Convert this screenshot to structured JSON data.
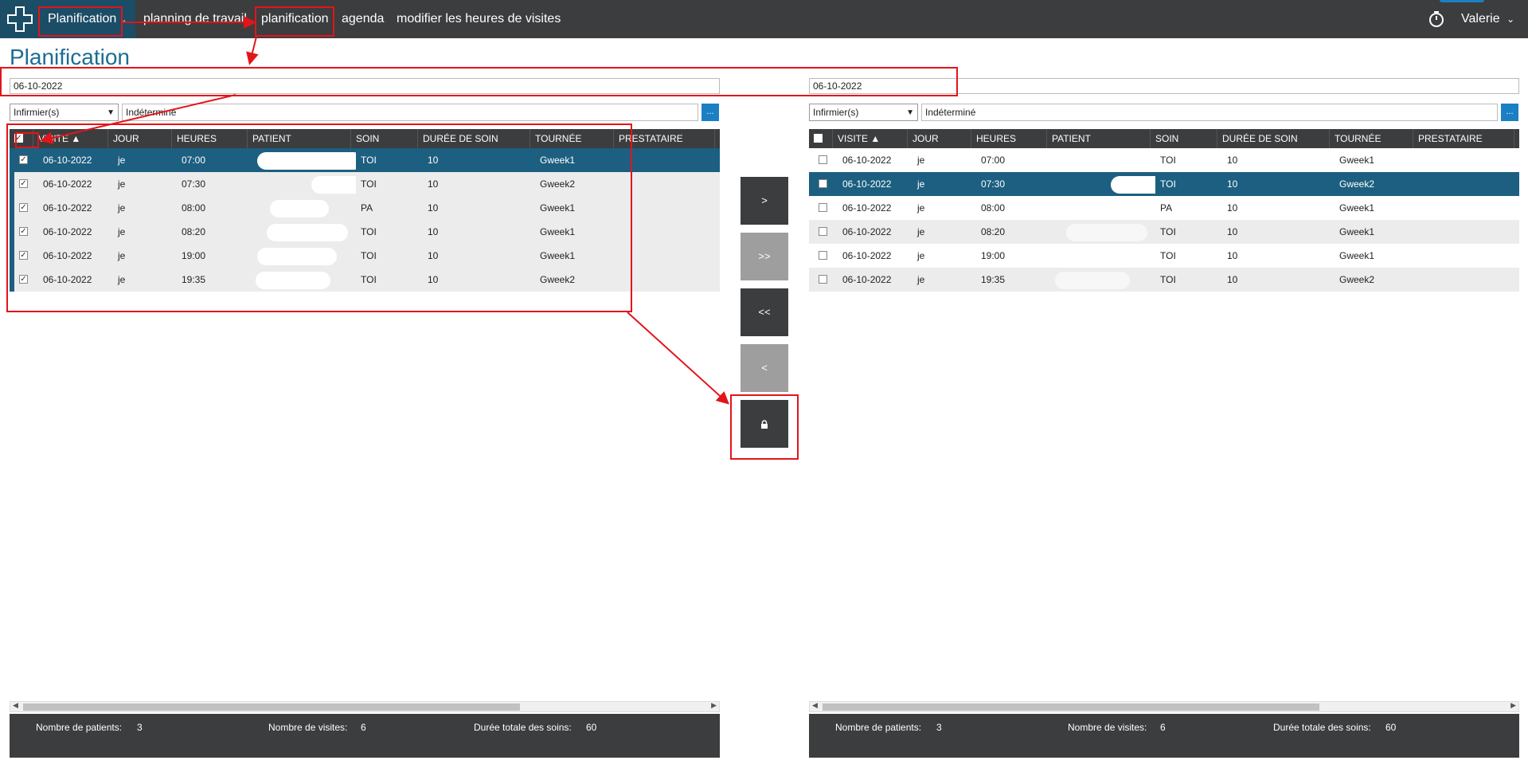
{
  "nav": {
    "app_menu": "Planification",
    "items": [
      "planning de travail",
      "planification",
      "agenda",
      "modifier les heures de visites"
    ],
    "user": "Valerie"
  },
  "page_title": "Planification",
  "columns": [
    "VISITE",
    "JOUR",
    "HEURES",
    "PATIENT",
    "SOIN",
    "DURÉE DE SOIN",
    "TOURNÉE",
    "PRESTATAIRE"
  ],
  "left": {
    "date": "06-10-2022",
    "role": "Infirmier(s)",
    "assignee": "Indéterminé",
    "rows": [
      {
        "visite": "06-10-2022",
        "jour": "je",
        "heures": "07:00",
        "soin": "TOI",
        "duree": "10",
        "tournee": "Gweek1"
      },
      {
        "visite": "06-10-2022",
        "jour": "je",
        "heures": "07:30",
        "soin": "TOI",
        "duree": "10",
        "tournee": "Gweek2"
      },
      {
        "visite": "06-10-2022",
        "jour": "je",
        "heures": "08:00",
        "soin": "PA",
        "duree": "10",
        "tournee": "Gweek1"
      },
      {
        "visite": "06-10-2022",
        "jour": "je",
        "heures": "08:20",
        "soin": "TOI",
        "duree": "10",
        "tournee": "Gweek1"
      },
      {
        "visite": "06-10-2022",
        "jour": "je",
        "heures": "19:00",
        "soin": "TOI",
        "duree": "10",
        "tournee": "Gweek1"
      },
      {
        "visite": "06-10-2022",
        "jour": "je",
        "heures": "19:35",
        "soin": "TOI",
        "duree": "10",
        "tournee": "Gweek2"
      }
    ],
    "footer": {
      "patients_label": "Nombre de patients:",
      "patients": "3",
      "visits_label": "Nombre de visites:",
      "visits": "6",
      "duration_label": "Durée totale des soins:",
      "duration": "60"
    }
  },
  "right": {
    "date": "06-10-2022",
    "role": "Infirmier(s)",
    "assignee": "Indéterminé",
    "rows": [
      {
        "visite": "06-10-2022",
        "jour": "je",
        "heures": "07:00",
        "soin": "TOI",
        "duree": "10",
        "tournee": "Gweek1"
      },
      {
        "visite": "06-10-2022",
        "jour": "je",
        "heures": "07:30",
        "soin": "TOI",
        "duree": "10",
        "tournee": "Gweek2"
      },
      {
        "visite": "06-10-2022",
        "jour": "je",
        "heures": "08:00",
        "soin": "PA",
        "duree": "10",
        "tournee": "Gweek1"
      },
      {
        "visite": "06-10-2022",
        "jour": "je",
        "heures": "08:20",
        "soin": "TOI",
        "duree": "10",
        "tournee": "Gweek1"
      },
      {
        "visite": "06-10-2022",
        "jour": "je",
        "heures": "19:00",
        "soin": "TOI",
        "duree": "10",
        "tournee": "Gweek1"
      },
      {
        "visite": "06-10-2022",
        "jour": "je",
        "heures": "19:35",
        "soin": "TOI",
        "duree": "10",
        "tournee": "Gweek2"
      }
    ],
    "footer": {
      "patients_label": "Nombre de patients:",
      "patients": "3",
      "visits_label": "Nombre de visites:",
      "visits": "6",
      "duration_label": "Durée totale des soins:",
      "duration": "60"
    }
  },
  "move_buttons": {
    "move_one": ">",
    "move_all": ">>",
    "back_all": "<<",
    "back_one": "<"
  },
  "colors": {
    "accent": "#1c5f80",
    "header": "#3c3d3e",
    "annotation": "#e3141a",
    "button_blue": "#1b7fc4"
  }
}
